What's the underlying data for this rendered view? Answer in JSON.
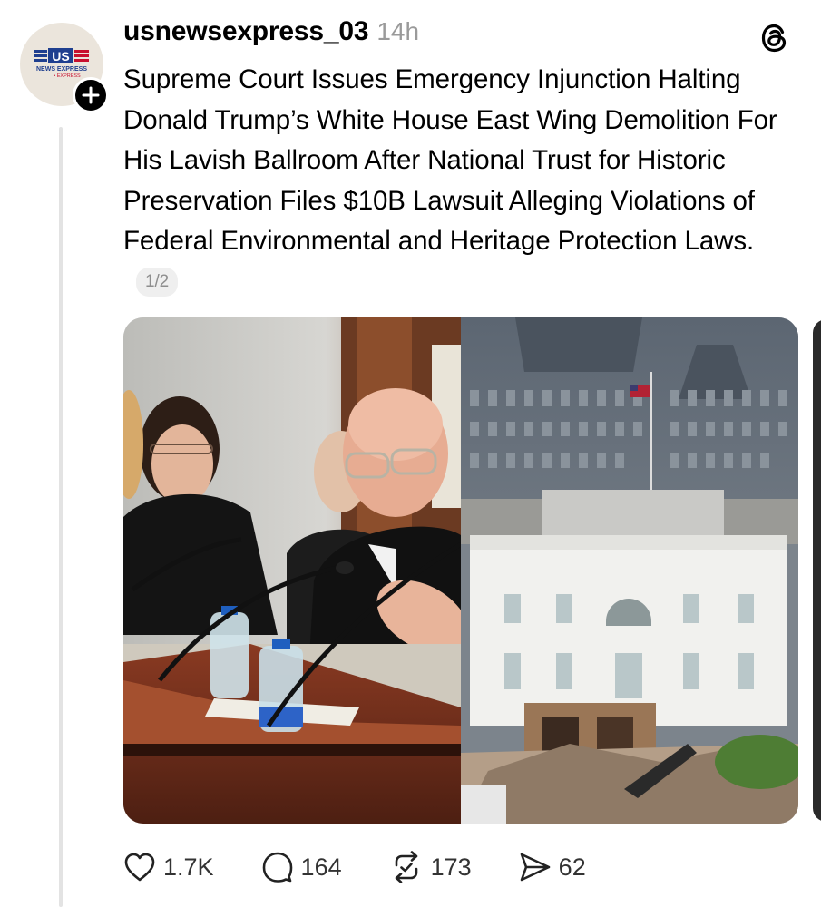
{
  "post": {
    "username": "usnewsexpress_03",
    "timestamp": "14h",
    "text": "Supreme Court Issues Emergency Injunction Halting Donald Trump’s White House East Wing Demolition For His Lavish Ballroom After National Trust for Historic Preservation Files $10B Lawsuit Alleging Violations of Federal Environmental and Heritage Protection Laws.",
    "page_indicator": "1/2",
    "avatar_logo_text": [
      "US",
      "NEWS EXPRESS",
      "EXPRESS"
    ]
  },
  "actions": {
    "likes": "1.7K",
    "replies": "164",
    "reposts": "173",
    "shares": "62"
  },
  "icons": {
    "like": "heart-icon",
    "reply": "comment-icon",
    "repost": "repost-icon",
    "share": "send-icon",
    "app": "threads-logo-icon",
    "follow": "plus-icon"
  },
  "colors": {
    "username": "#000000",
    "timestamp": "#9a9a9a",
    "thread_line": "#e3e3e3",
    "avatar_bg": "#ebe5dc",
    "logo_red": "#c8102e",
    "logo_blue": "#1f3f8f"
  }
}
